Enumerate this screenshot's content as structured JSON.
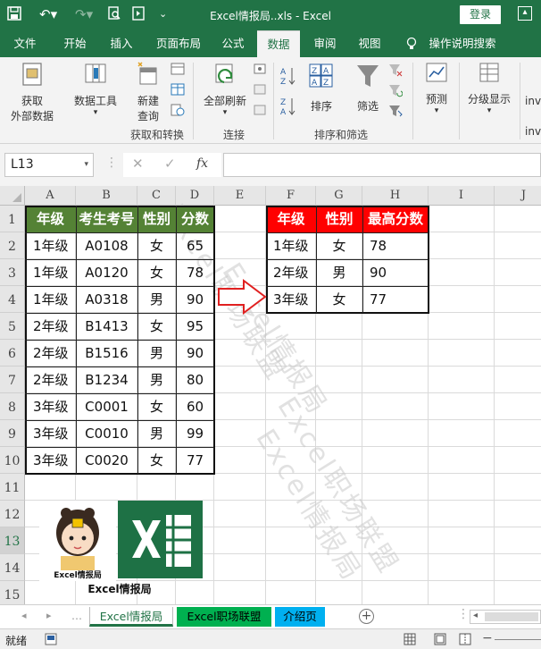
{
  "titlebar": {
    "title": "Excel情报局..xls  -  Excel",
    "login": "登录"
  },
  "tabs": [
    "文件",
    "开始",
    "插入",
    "页面布局",
    "公式",
    "数据",
    "审阅",
    "视图",
    "操作说明搜索"
  ],
  "active_tab": "数据",
  "ribbon": {
    "get_data": [
      "获取",
      "外部数据"
    ],
    "data_tools": "数据工具",
    "new_query": [
      "新建",
      "查询"
    ],
    "group_get": "获取和转换",
    "refresh_all": "全部刷新",
    "group_connect": "连接",
    "sort": "排序",
    "filter": "筛选",
    "group_sort": "排序和筛选",
    "forecast": "预测",
    "outline": "分级显示",
    "inv1": "inv",
    "inv2": "inv"
  },
  "formula_bar": {
    "name_box": "L13",
    "fx": "fx",
    "formula": ""
  },
  "columns": [
    "A",
    "B",
    "C",
    "D",
    "E",
    "F",
    "G",
    "H",
    "I",
    "J"
  ],
  "rows": [
    "1",
    "2",
    "3",
    "4",
    "5",
    "6",
    "7",
    "8",
    "9",
    "10",
    "11",
    "12",
    "13",
    "14",
    "15"
  ],
  "selected_row": "13",
  "table1": {
    "header": [
      "年级",
      "考生考号",
      "性别",
      "分数"
    ],
    "header_color": "#548235",
    "rows": [
      [
        "1年级",
        "A0108",
        "女",
        "65"
      ],
      [
        "1年级",
        "A0120",
        "女",
        "78"
      ],
      [
        "1年级",
        "A0318",
        "男",
        "90"
      ],
      [
        "2年级",
        "B1413",
        "女",
        "95"
      ],
      [
        "2年级",
        "B1516",
        "男",
        "90"
      ],
      [
        "2年级",
        "B1234",
        "男",
        "80"
      ],
      [
        "3年级",
        "C0001",
        "女",
        "60"
      ],
      [
        "3年级",
        "C0010",
        "男",
        "99"
      ],
      [
        "3年级",
        "C0020",
        "女",
        "77"
      ]
    ]
  },
  "table2": {
    "header": [
      "年级",
      "性别",
      "最高分数"
    ],
    "header_color": "#ff0000",
    "rows": [
      [
        "1年级",
        "女",
        "78"
      ],
      [
        "2年级",
        "男",
        "90"
      ],
      [
        "3年级",
        "女",
        "77"
      ]
    ]
  },
  "logo": {
    "avatar_caption": "Excel情报局",
    "caption": "Excel情报局",
    "excel_color": "#1e7145"
  },
  "watermarks": [
    "Excel职场联盟",
    "Excel情报局",
    "Excel职场联盟",
    "Excel情报局"
  ],
  "sheet_tabs": [
    {
      "label": "Excel情报局",
      "color": "#ffffff",
      "text": "#217346"
    },
    {
      "label": "Excel职场联盟",
      "color": "#00b050",
      "text": "#000000"
    },
    {
      "label": "介绍页",
      "color": "#00b0f0",
      "text": "#000000"
    }
  ],
  "status": {
    "ready": "就绪"
  }
}
